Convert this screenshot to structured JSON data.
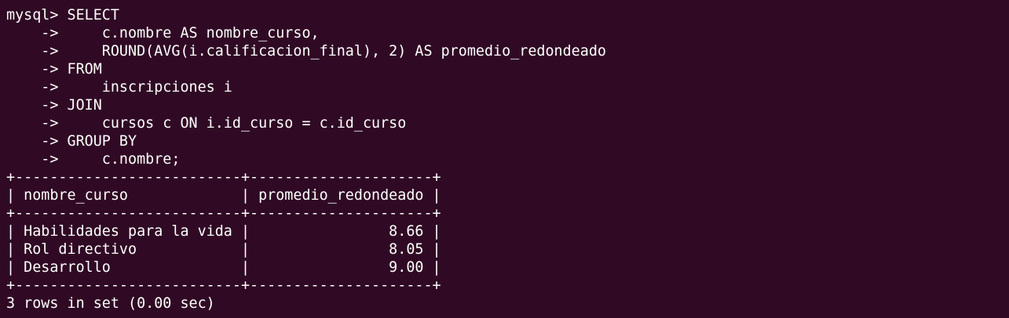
{
  "terminal": {
    "background": "#300a24",
    "foreground": "#ffffff",
    "lines": [
      "mysql> SELECT",
      "    ->     c.nombre AS nombre_curso,",
      "    ->     ROUND(AVG(i.calificacion_final), 2) AS promedio_redondeado",
      "    -> FROM",
      "    ->     inscripciones i",
      "    -> JOIN",
      "    ->     cursos c ON i.id_curso = c.id_curso",
      "    -> GROUP BY",
      "    ->     c.nombre;",
      "+--------------------------+---------------------+",
      "| nombre_curso             | promedio_redondeado |",
      "+--------------------------+---------------------+",
      "| Habilidades para la vida |                8.66 |",
      "| Rol directivo            |                8.05 |",
      "| Desarrollo               |                9.00 |",
      "+--------------------------+---------------------+",
      "3 rows in set (0.00 sec)"
    ]
  }
}
